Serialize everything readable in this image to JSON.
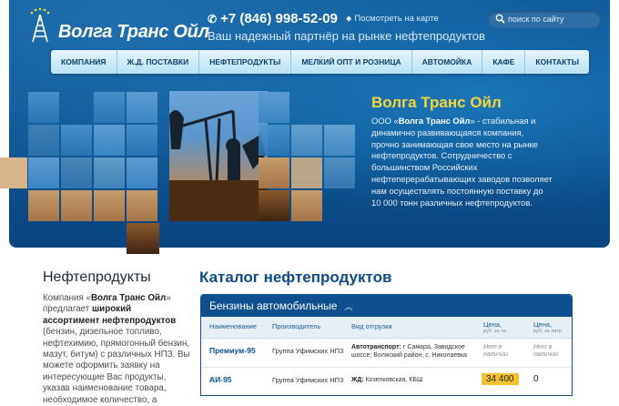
{
  "header": {
    "logo_text": "Волга Транс Ойл",
    "phone": "+7 (846) 998-52-09",
    "map_link": "Посмотреть на карте",
    "tagline": "Ваш надежный партнёр на рынке нефтепродуктов",
    "search_placeholder": "поиск по сайту"
  },
  "nav": {
    "items": [
      "КОМПАНИЯ",
      "Ж.Д. ПОСТАВКИ",
      "НЕФТЕПРОДУКТЫ",
      "МЕЛКИЙ ОПТ И РОЗНИЦА",
      "АВТОМОЙКА",
      "КАФЕ",
      "КОНТАКТЫ"
    ]
  },
  "hero": {
    "title": "Волга Транс Ойл",
    "prefix": "ООО «",
    "company": "Волга Транс Ойл",
    "text": "» - стабильная и динамично развивающаяся компания, прочно занимающая свое место на рынке нефтепродуктов. Сотрудничество с большинством Российских нефтеперерабатывающих заводов позволяет нам осуществлять постоянную поставку до 10 000 тонн различных нефтепродуктов."
  },
  "left": {
    "title": "Нефтепродукты",
    "p1": "Компания «",
    "company": "Волга Транс Ойл",
    "p2": "» предлагает ",
    "bold1": "широкий ассортимент нефтепродуктов",
    "p3": " (бензин, дизельное топливо, нефтехимию, прямогонный бензин, мазут, битум) с различных НПЗ. Вы можете оформить заявку на интересующие Вас продукты, указав наименование товара, необходимое количество, а"
  },
  "catalog": {
    "title": "Каталог нефтепродуктов",
    "section": "Бензины автомобильные",
    "columns": {
      "name": "Наименование",
      "producer": "Производитель",
      "shipping": "Вид отгрузки",
      "price_t": "Цена,",
      "price_t_unit": "руб. за тн.",
      "price_l": "Цена,",
      "price_l_unit": "руб. за литр."
    },
    "rows": [
      {
        "name": "Премиум-95",
        "producer": "Группа Уфимских НПЗ",
        "ship_label": "Автотранспорт:",
        "ship_text1": " г Самара, Заводское",
        "ship_text2": "шоссе; Волжский район, с. Николаевка",
        "price_t_1": "Нет в",
        "price_t_2": "наличии",
        "price_l_1": "Нет в",
        "price_l_2": "наличии"
      },
      {
        "name": "АИ-95",
        "producer": "Группа Уфимских НПЗ",
        "ship_label": "ЖД:",
        "ship_text1": " Козелковская, КБШ",
        "ship_text2": "",
        "price_t": "34 400",
        "price_l": "0"
      }
    ]
  },
  "colors": {
    "hero_blue": "#0b4f8d",
    "accent_yellow": "#f2d63b",
    "nav_bg": "#b9e2f4",
    "price_badge": "#f2c230"
  },
  "icons": [
    "oil-tower-logo-icon",
    "phone-icon",
    "map-pin-icon",
    "search-icon",
    "chevron-up-icon"
  ]
}
